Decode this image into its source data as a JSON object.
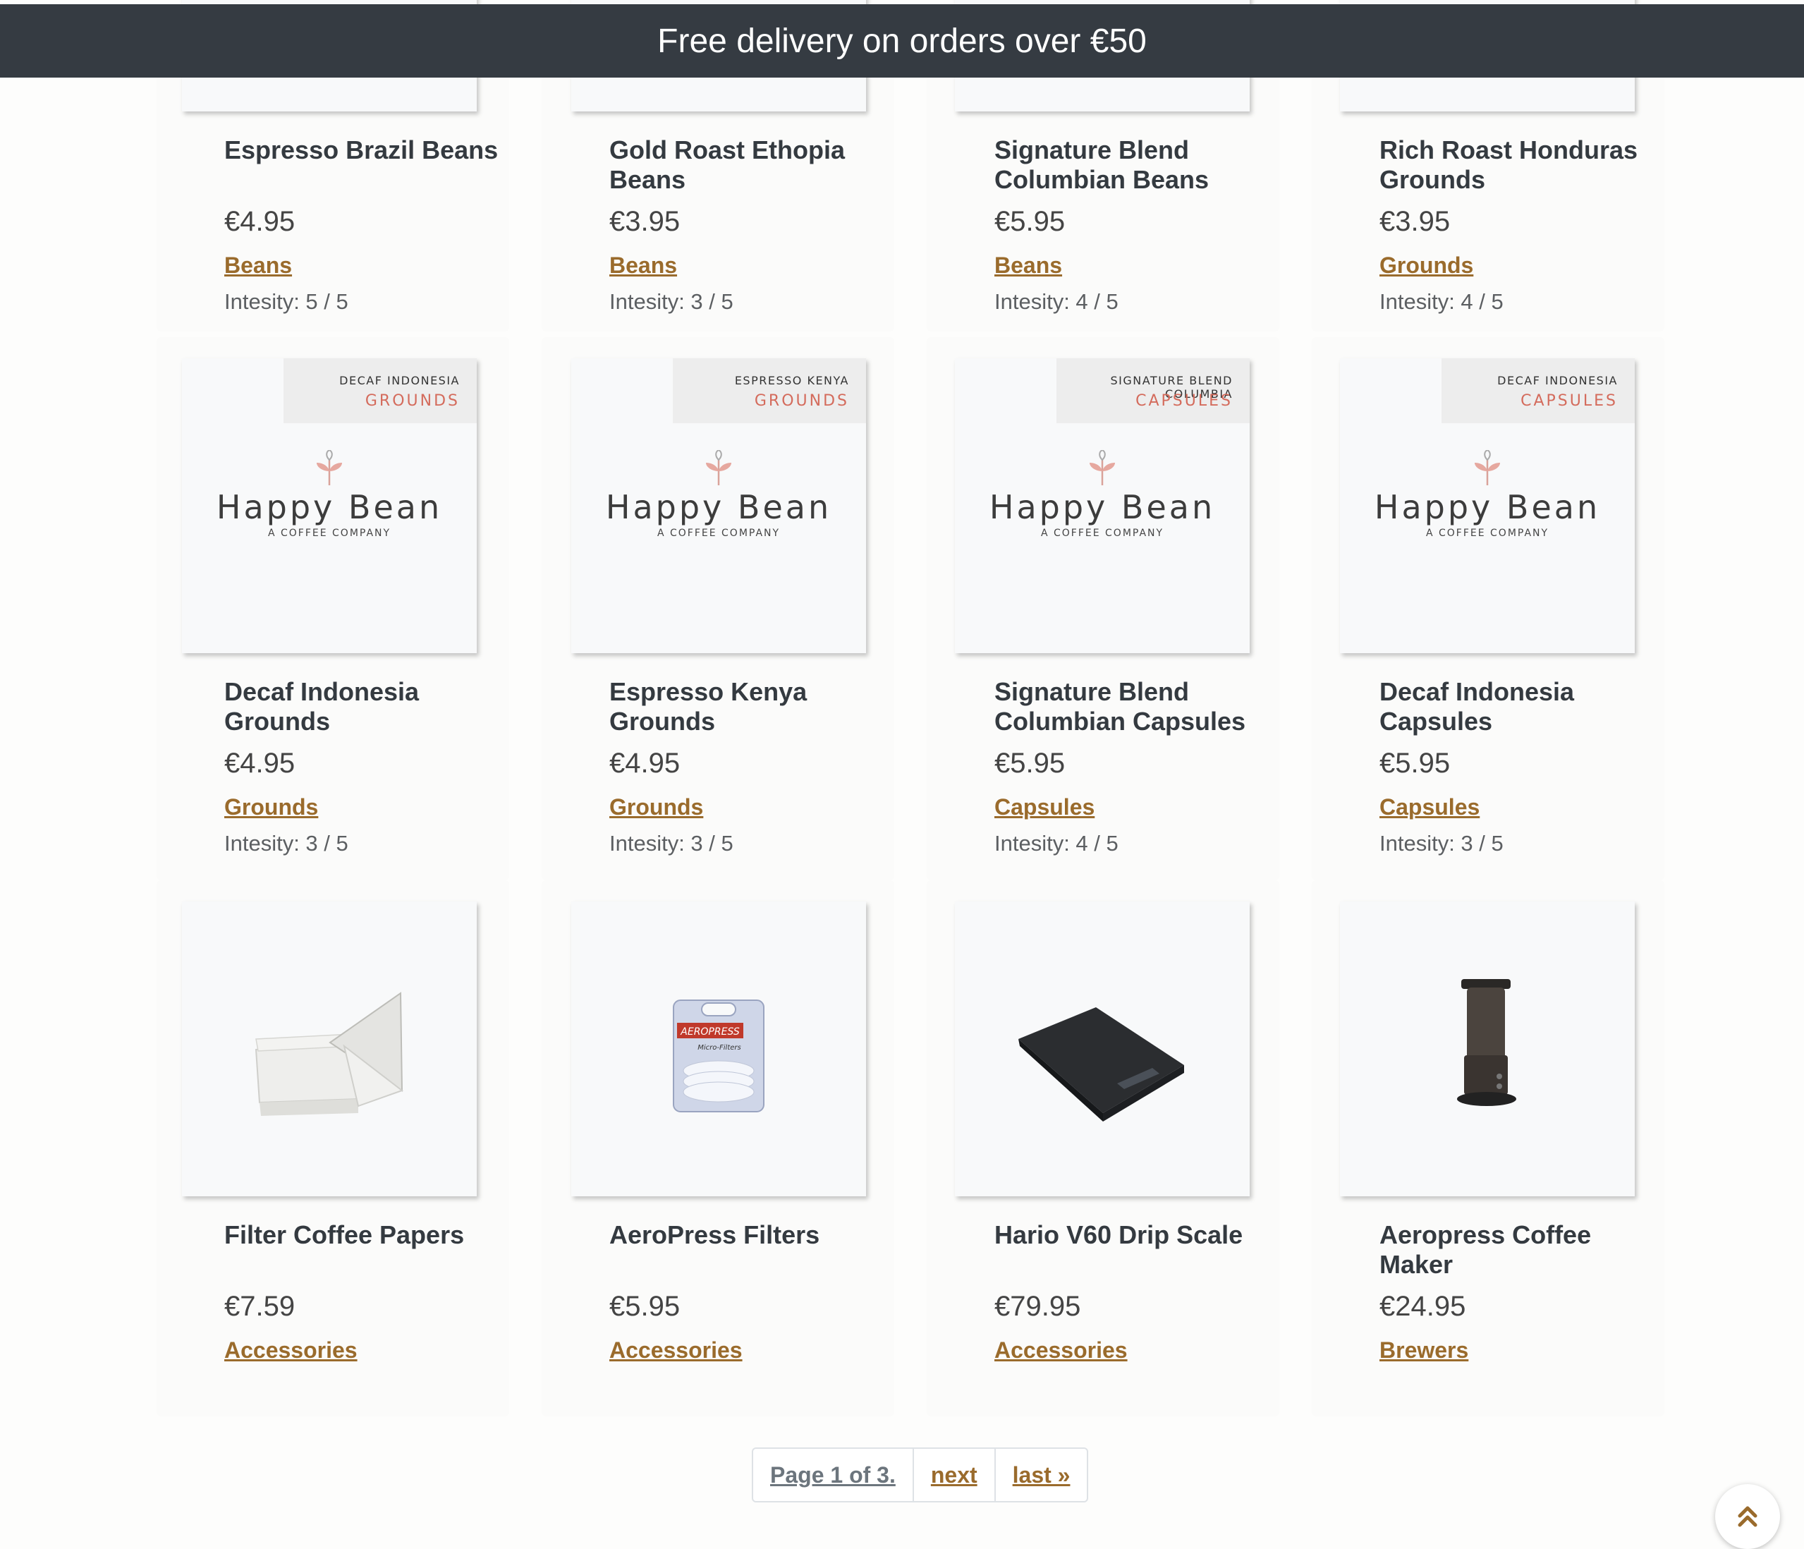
{
  "banner": {
    "text": "Free delivery on orders over €50"
  },
  "products": [
    {
      "title": "Espresso Brazil Beans",
      "price": "€4.95",
      "category": "Beans",
      "intensity": "Intesity: 5 / 5",
      "image": "happy-bean-bag"
    },
    {
      "title": "Gold Roast Ethopia Beans",
      "price": "€3.95",
      "category": "Beans",
      "intensity": "Intesity: 3 / 5",
      "image": "happy-bean-bag"
    },
    {
      "title": "Signature Blend Columbian Beans",
      "price": "€5.95",
      "category": "Beans",
      "intensity": "Intesity: 4 / 5",
      "image": "happy-bean-bag"
    },
    {
      "title": "Rich Roast Honduras Grounds",
      "price": "€3.95",
      "category": "Grounds",
      "intensity": "Intesity: 4 / 5",
      "image": "happy-bean-bag"
    },
    {
      "title": "Decaf Indonesia Grounds",
      "price": "€4.95",
      "category": "Grounds",
      "intensity": "Intesity: 3 / 5",
      "image": "happy-bean-bag",
      "label_origin": "DECAF INDONESIA",
      "label_type": "GROUNDS"
    },
    {
      "title": "Espresso Kenya Grounds",
      "price": "€4.95",
      "category": "Grounds",
      "intensity": "Intesity: 3 / 5",
      "image": "happy-bean-bag",
      "label_origin": "ESPRESSO KENYA",
      "label_type": "GROUNDS"
    },
    {
      "title": "Signature Blend Columbian Capsules",
      "price": "€5.95",
      "category": "Capsules",
      "intensity": "Intesity: 4 / 5",
      "image": "happy-bean-bag",
      "label_origin": "SIGNATURE BLEND COLUMBIA",
      "label_type": "CAPSULES"
    },
    {
      "title": "Decaf Indonesia Capsules",
      "price": "€5.95",
      "category": "Capsules",
      "intensity": "Intesity: 3 / 5",
      "image": "happy-bean-bag",
      "label_origin": "DECAF INDONESIA",
      "label_type": "CAPSULES"
    },
    {
      "title": "Filter Coffee Papers",
      "price": "€7.59",
      "category": "Accessories",
      "image": "filter-papers"
    },
    {
      "title": "AeroPress Filters",
      "price": "€5.95",
      "category": "Accessories",
      "image": "aeropress-filters",
      "pack_brand": "AEROPRESS",
      "pack_text": "Micro-Filters"
    },
    {
      "title": "Hario V60 Drip Scale",
      "price": "€79.95",
      "category": "Accessories",
      "image": "drip-scale"
    },
    {
      "title": "Aeropress Coffee Maker",
      "price": "€24.95",
      "category": "Brewers",
      "image": "aeropress-maker"
    }
  ],
  "brand": {
    "name": "Happy Bean",
    "tagline": "A COFFEE COMPANY"
  },
  "pagination": {
    "current": "Page 1 of 3.",
    "next": "next",
    "last": "last »"
  },
  "colors": {
    "banner": "#353b42",
    "link": "#9a6b2c",
    "label_accent": "#d46b5c"
  },
  "icons": {
    "scroll_top": "double-chevron-up-icon",
    "brand_logo": "leaf-icon"
  }
}
